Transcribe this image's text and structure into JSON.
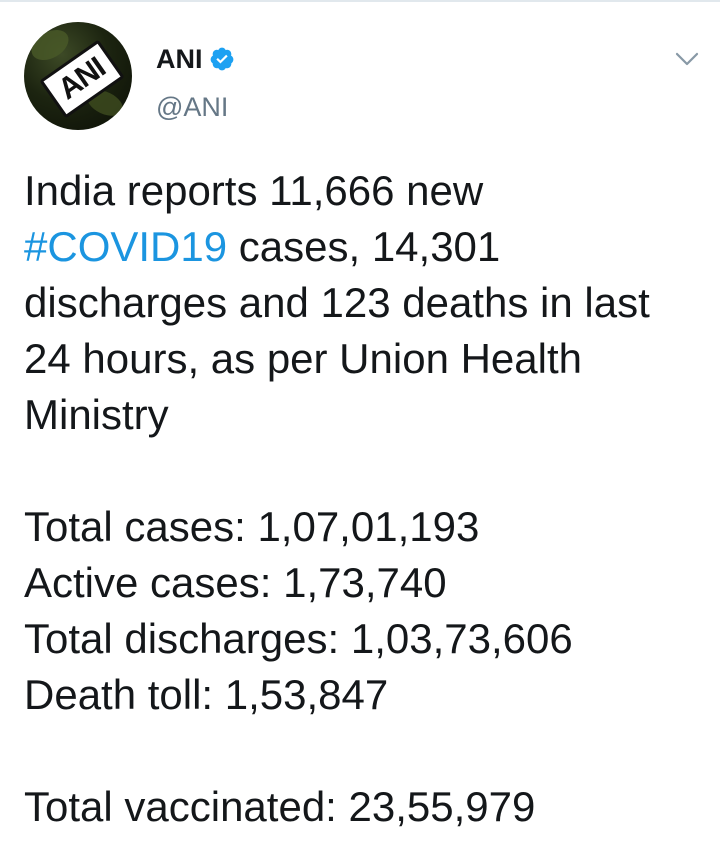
{
  "tweet": {
    "author": {
      "display_name": "ANI",
      "handle": "@ANI",
      "avatar_logo_text": "ANI",
      "verified": true
    },
    "body": {
      "sentence_part1": "India reports 11,666 new",
      "hashtag": "#COVID19",
      "sentence_part2": " cases, 14,301 discharges and 123 deaths in last 24 hours, as per Union Health Ministry"
    },
    "stats": [
      {
        "text": "Total cases: 1,07,01,193"
      },
      {
        "text": "Active cases: 1,73,740"
      },
      {
        "text": "Total discharges: 1,03,73,606"
      },
      {
        "text": "Death toll: 1,53,847"
      }
    ],
    "vaccinated": "Total vaccinated: 23,55,979"
  },
  "colors": {
    "text_primary": "#14171a",
    "text_secondary": "#657786",
    "hashtag": "#1b95e0",
    "verified": "#1da1f2",
    "chevron": "#8899a6"
  },
  "icons": {
    "verified": "verified-badge-icon",
    "menu": "chevron-down-icon"
  }
}
